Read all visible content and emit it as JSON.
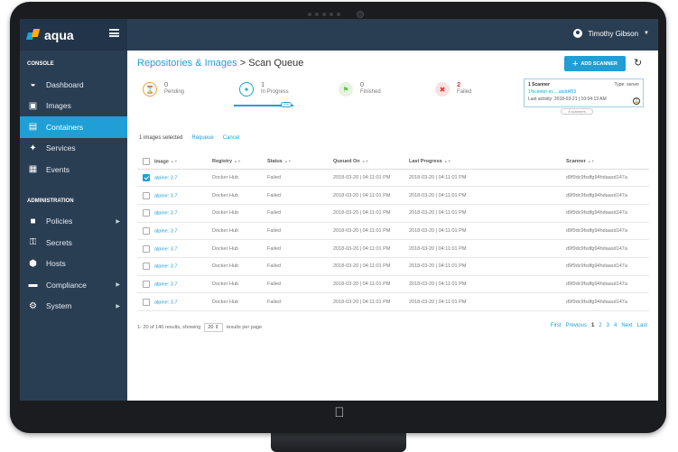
{
  "brand": {
    "name": "aqua"
  },
  "sidebar": {
    "console_label": "CONSOLE",
    "admin_label": "ADMINISTRATION",
    "console_items": [
      {
        "label": "Dashboard",
        "icon": "dashboard-icon"
      },
      {
        "label": "Images",
        "icon": "images-icon"
      },
      {
        "label": "Containers",
        "icon": "containers-icon",
        "active": true
      },
      {
        "label": "Services",
        "icon": "services-icon"
      },
      {
        "label": "Events",
        "icon": "events-icon"
      }
    ],
    "admin_items": [
      {
        "label": "Policies",
        "icon": "lock-icon",
        "has_submenu": true
      },
      {
        "label": "Secrets",
        "icon": "key-icon"
      },
      {
        "label": "Hosts",
        "icon": "hosts-icon"
      },
      {
        "label": "Compliance",
        "icon": "briefcase-icon",
        "has_submenu": true
      },
      {
        "label": "System",
        "icon": "gear-icon",
        "has_submenu": true
      }
    ]
  },
  "header": {
    "user_name": "Timothy Gibson"
  },
  "page": {
    "breadcrumb_link": "Repositories & Images",
    "breadcrumb_separator": ">",
    "breadcrumb_current": "Scan Queue",
    "add_scanner_label": "ADD SCANNER"
  },
  "status_tiles": [
    {
      "count": "0",
      "label": "Pending",
      "color": "#f0a030"
    },
    {
      "count": "1",
      "label": "In Progress",
      "color": "#1f9fd6"
    },
    {
      "count": "0",
      "label": "Finished",
      "color": "#6cbf5a"
    },
    {
      "count": "2",
      "label": "Failed",
      "color": "#e03a3a"
    }
  ],
  "in_progress_pill": "0%",
  "scanner_card": {
    "title": "1 Scanner",
    "type": "Type: server",
    "name": "1%center-er.....asdd453",
    "last_activity": "Last activity: 2018-03-21 | 10:04:13 AM",
    "pill": "4 scanners"
  },
  "selection": {
    "count_text": "1 images selected",
    "requeue": "Requeue",
    "cancel": "Cancel"
  },
  "table": {
    "headers": [
      "Image",
      "Registry",
      "Status",
      "Queued On",
      "Last Progress",
      "Scanner"
    ],
    "rows": [
      {
        "image": "alpine: 3.7",
        "registry": "Docker Hub",
        "status": "Failed",
        "queued": "2018-03-20 | 04:11:01 PM",
        "progress": "2018-03-20 | 04:11:01 PM",
        "scanner": "d9f9dc9fsdfg94hdaasd147a",
        "checked": true
      },
      {
        "image": "alpine: 3.7",
        "registry": "Docker Hub",
        "status": "Failed",
        "queued": "2018-03-20 | 04:11:01 PM",
        "progress": "2018-03-20 | 04:11:01 PM",
        "scanner": "d9f9dc9fsdfg94hdaasd147a",
        "checked": false
      },
      {
        "image": "alpine: 3.7",
        "registry": "Docker Hub",
        "status": "Failed",
        "queued": "2018-03-20 | 04:11:01 PM",
        "progress": "2018-03-20 | 04:11:01 PM",
        "scanner": "d9f9dc9fsdfg94hdaasd147a",
        "checked": false
      },
      {
        "image": "alpine: 3.7",
        "registry": "Docker Hub",
        "status": "Failed",
        "queued": "2018-03-20 | 04:11:01 PM",
        "progress": "2018-03-20 | 04:11:01 PM",
        "scanner": "d9f9dc9fsdfg94hdaasd147a",
        "checked": false
      },
      {
        "image": "alpine: 3.7",
        "registry": "Docker Hub",
        "status": "Failed",
        "queued": "2018-03-20 | 04:11:01 PM",
        "progress": "2018-03-20 | 04:11:01 PM",
        "scanner": "d9f9dc9fsdfg94hdaasd147a",
        "checked": false
      },
      {
        "image": "alpine: 3.7",
        "registry": "Docker Hub",
        "status": "Failed",
        "queued": "2018-03-20 | 04:11:01 PM",
        "progress": "2018-03-20 | 04:11:01 PM",
        "scanner": "d9f9dc9fsdfg94hdaasd147a",
        "checked": false
      },
      {
        "image": "alpine: 3.7",
        "registry": "Docker Hub",
        "status": "Failed",
        "queued": "2018-03-20 | 04:11:01 PM",
        "progress": "2018-03-20 | 04:11:01 PM",
        "scanner": "d9f9dc9fsdfg94hdaasd147a",
        "checked": false
      },
      {
        "image": "alpine: 3.7",
        "registry": "Docker Hub",
        "status": "Failed",
        "queued": "2018-03-20 | 04:11:01 PM",
        "progress": "2018-03-20 | 04:11:01 PM",
        "scanner": "d9f9dc9fsdfg94hdaasd147a",
        "checked": false
      }
    ]
  },
  "footer": {
    "results_prefix": "1- 20 of 140 results, showing",
    "per_page": "20",
    "results_suffix": "results per page"
  },
  "pagination": {
    "first": "First",
    "previous": "Previous",
    "pages": [
      "1",
      "2",
      "3",
      "4"
    ],
    "current": "1",
    "next": "Next",
    "last": "Last"
  }
}
